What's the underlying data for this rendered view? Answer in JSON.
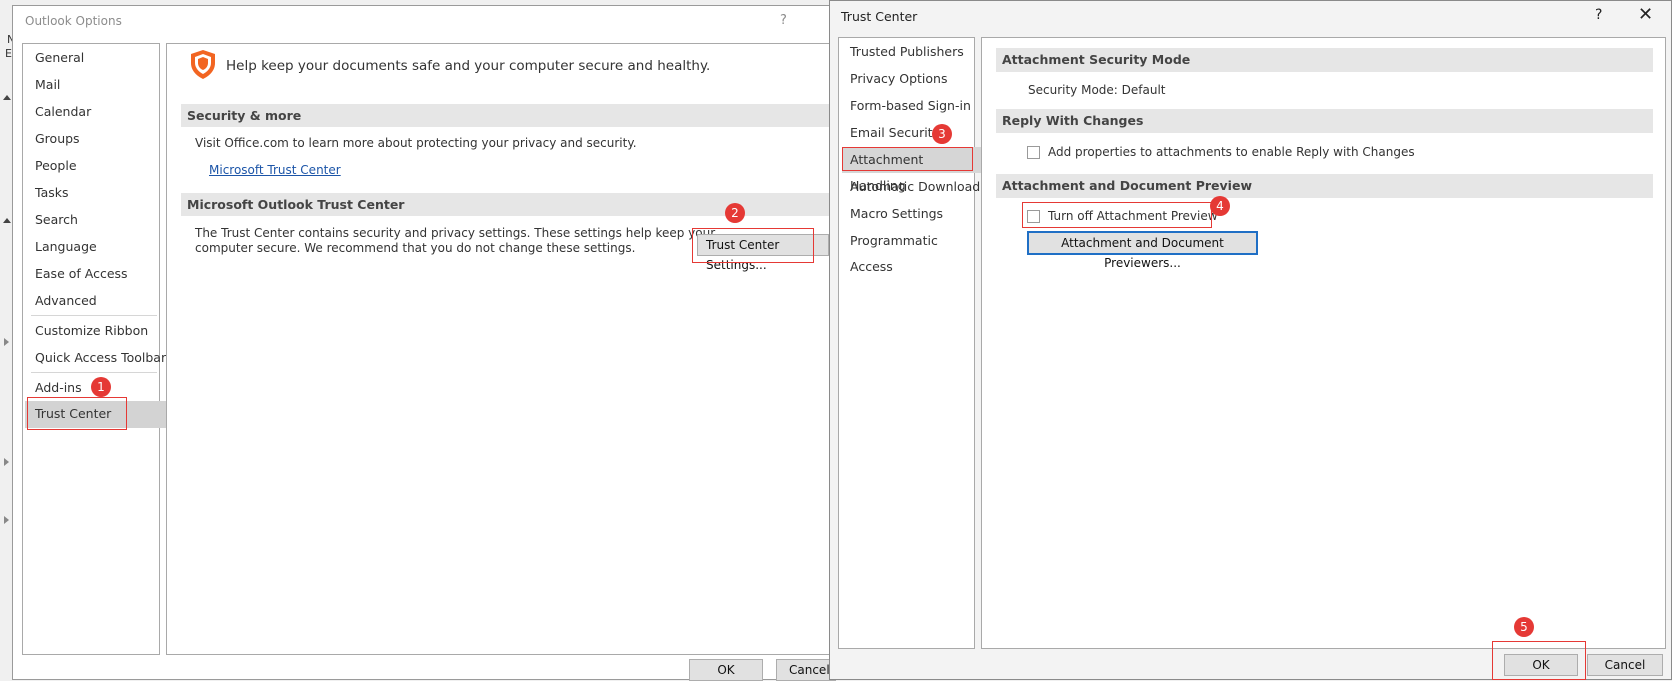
{
  "background": {
    "letters": [
      "N",
      "Er"
    ]
  },
  "outlook_options": {
    "title": "Outlook Options",
    "help": "?",
    "nav": [
      "General",
      "Mail",
      "Calendar",
      "Groups",
      "People",
      "Tasks",
      "Search",
      "Language",
      "Ease of Access",
      "Advanced",
      "Customize Ribbon",
      "Quick Access Toolbar",
      "Add-ins",
      "Trust Center"
    ],
    "selected_nav": "Trust Center",
    "headline": "Help keep your documents safe and your computer secure and healthy.",
    "section1": {
      "title": "Security & more",
      "text": "Visit Office.com to learn more about protecting your privacy and security.",
      "link": "Microsoft Trust Center"
    },
    "section2": {
      "title": "Microsoft Outlook Trust Center",
      "text_line1": "The Trust Center contains security and privacy settings. These settings help keep your",
      "text_line2": "computer secure. We recommend that you do not change these settings.",
      "button": "Trust Center Settings..."
    },
    "ok": "OK",
    "cancel": "Cancel"
  },
  "trust_center": {
    "title": "Trust Center",
    "help": "?",
    "close": "✕",
    "nav": [
      "Trusted Publishers",
      "Privacy Options",
      "Form-based Sign-in",
      "Email Security",
      "Attachment Handling",
      "Automatic Download",
      "Macro Settings",
      "Programmatic Access"
    ],
    "selected_nav": "Attachment Handling",
    "sections": {
      "security_mode_title": "Attachment Security Mode",
      "security_mode_value": "Security Mode: Default",
      "reply_title": "Reply With Changes",
      "reply_checkbox": "Add properties to attachments to enable Reply with Changes",
      "preview_title": "Attachment and Document Preview",
      "preview_checkbox": "Turn off Attachment Preview",
      "previewers_button": "Attachment and Document Previewers..."
    },
    "ok": "OK",
    "cancel": "Cancel"
  },
  "callouts": [
    "1",
    "2",
    "3",
    "4",
    "5"
  ],
  "colors": {
    "highlight_red": "#e53935",
    "link_blue": "#1c55a8",
    "shield_orange": "#f26522",
    "focus_blue": "#1f6fc5"
  }
}
